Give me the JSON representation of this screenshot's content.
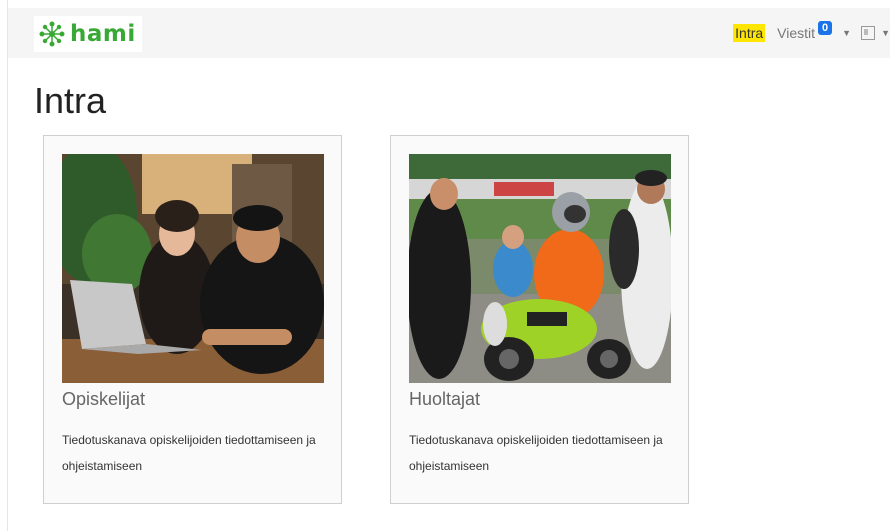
{
  "header": {
    "brand": "hami",
    "nav": {
      "intra": "Intra",
      "viestit": "Viestit",
      "viestit_count": "0"
    }
  },
  "page": {
    "title": "Intra"
  },
  "cards": [
    {
      "title": "Opiskelijat",
      "description": "Tiedotuskanava opiskelijoiden tiedottamiseen ja ohjeistamiseen"
    },
    {
      "title": "Huoltajat",
      "description": "Tiedotuskanava opiskelijoiden tiedottamiseen ja ohjeistamiseen"
    }
  ],
  "colors": {
    "brand_green": "#39a935",
    "highlight": "#ffe600",
    "badge": "#1a73e8"
  }
}
